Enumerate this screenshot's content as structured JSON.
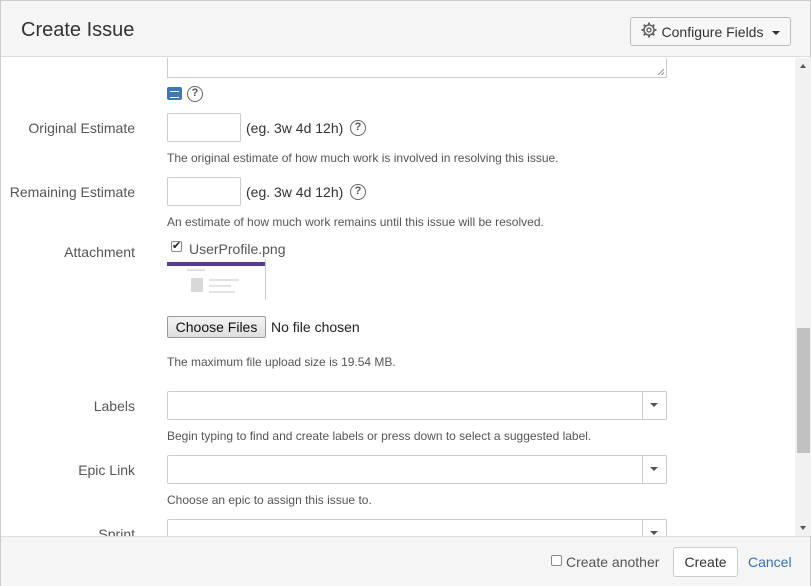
{
  "header": {
    "title": "Create Issue",
    "configure_fields_label": "Configure Fields"
  },
  "form": {
    "original_estimate": {
      "label": "Original Estimate",
      "value": "",
      "hint": "(eg. 3w 4d 12h)",
      "help": "The original estimate of how much work is involved in resolving this issue."
    },
    "remaining_estimate": {
      "label": "Remaining Estimate",
      "value": "",
      "hint": "(eg. 3w 4d 12h)",
      "help": "An estimate of how much work remains until this issue will be resolved."
    },
    "attachment": {
      "label": "Attachment",
      "file_name": "UserProfile.png",
      "file_checked": true,
      "choose_files_label": "Choose Files",
      "no_file_text": "No file chosen",
      "help": "The maximum file upload size is 19.54 MB."
    },
    "labels": {
      "label": "Labels",
      "value": "",
      "help": "Begin typing to find and create labels or press down to select a suggested label."
    },
    "epic_link": {
      "label": "Epic Link",
      "value": "",
      "help": "Choose an epic to assign this issue to."
    },
    "sprint": {
      "label": "Sprint",
      "value": ""
    }
  },
  "footer": {
    "create_another_label": "Create another",
    "create_another_checked": false,
    "create_label": "Create",
    "cancel_label": "Cancel"
  },
  "icons": {
    "configure": "gear-icon",
    "help": "question-circle-icon",
    "wiki_style": "wiki-style-icon"
  },
  "colors": {
    "link": "#3572b0",
    "wiki_icon": "#3a79b6"
  }
}
